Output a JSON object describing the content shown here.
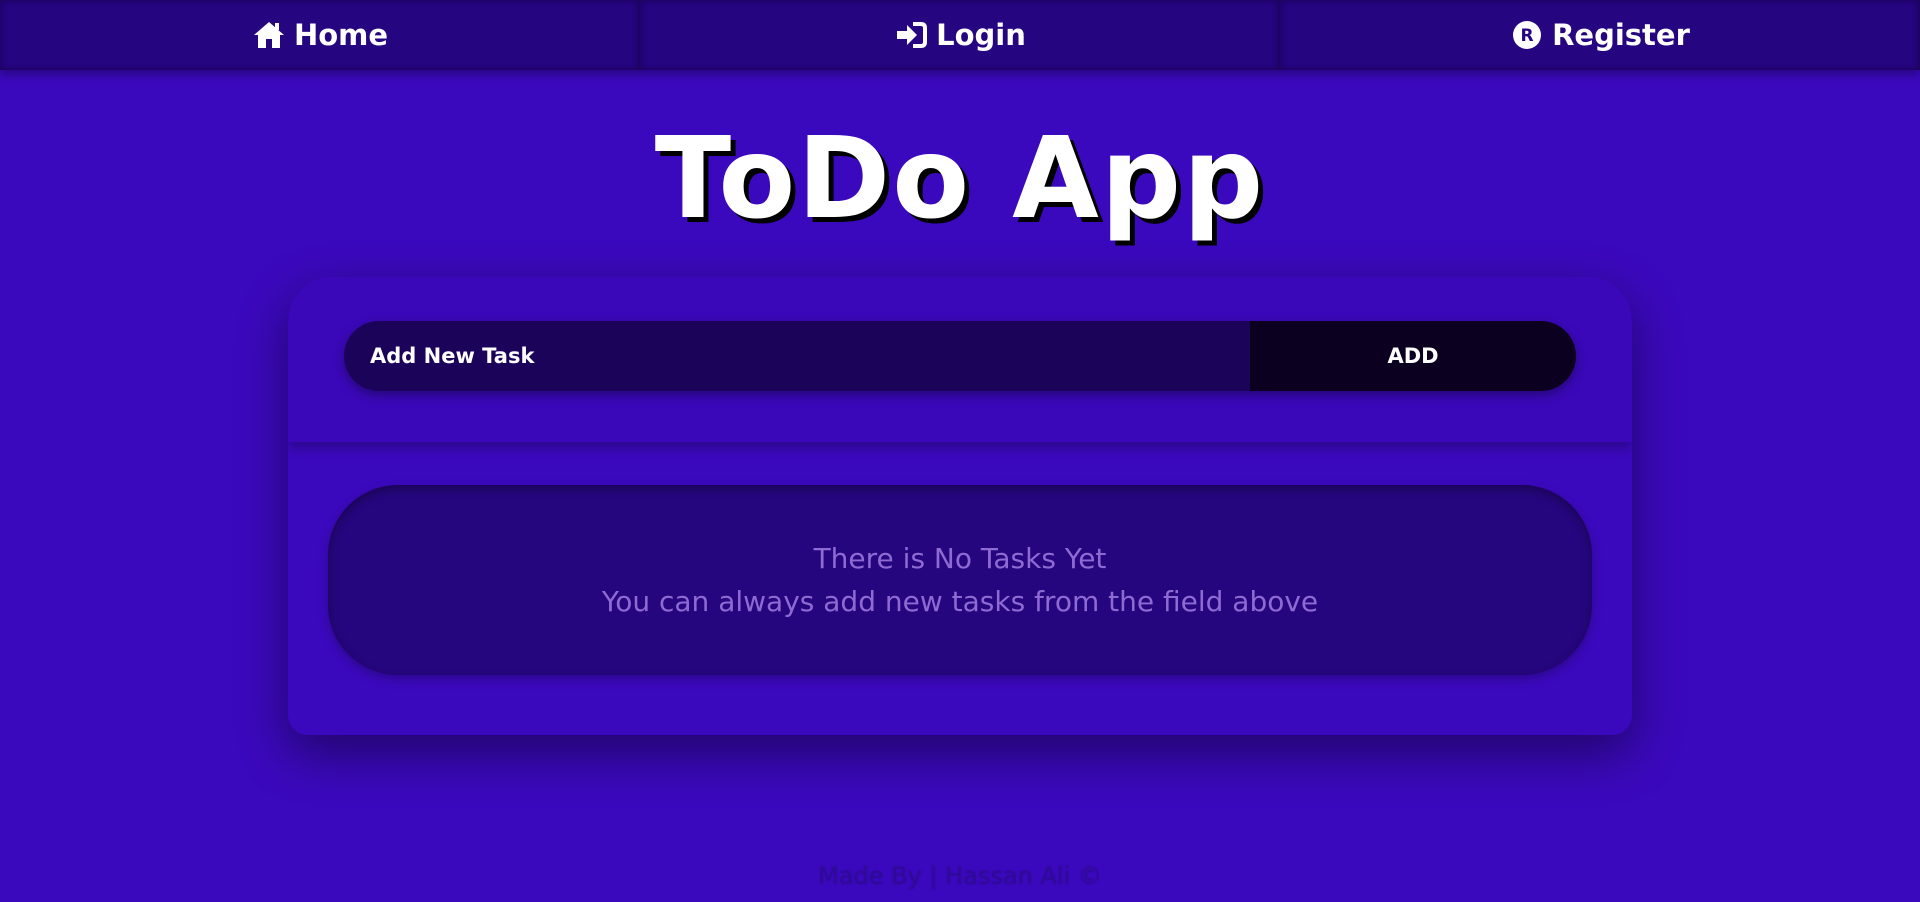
{
  "nav": {
    "items": [
      {
        "label": "Home",
        "icon": "home-icon"
      },
      {
        "label": "Login",
        "icon": "sign-in-icon"
      },
      {
        "label": "Register",
        "icon": "registered-icon"
      }
    ]
  },
  "title": "ToDo App",
  "form": {
    "placeholder": "Add New Task",
    "value": "",
    "add_label": "ADD"
  },
  "empty_state": {
    "line1": "There is No Tasks Yet",
    "line2": "You can always add new tasks from the field above"
  },
  "footer": {
    "text": "Made By | Hassan Ali ©"
  },
  "colors": {
    "background": "#3b09bd",
    "navbar": "#260580",
    "input": "#1c035a",
    "button": "#0b001f",
    "empty_box": "#26067f",
    "empty_text": "#8e6ad3"
  }
}
